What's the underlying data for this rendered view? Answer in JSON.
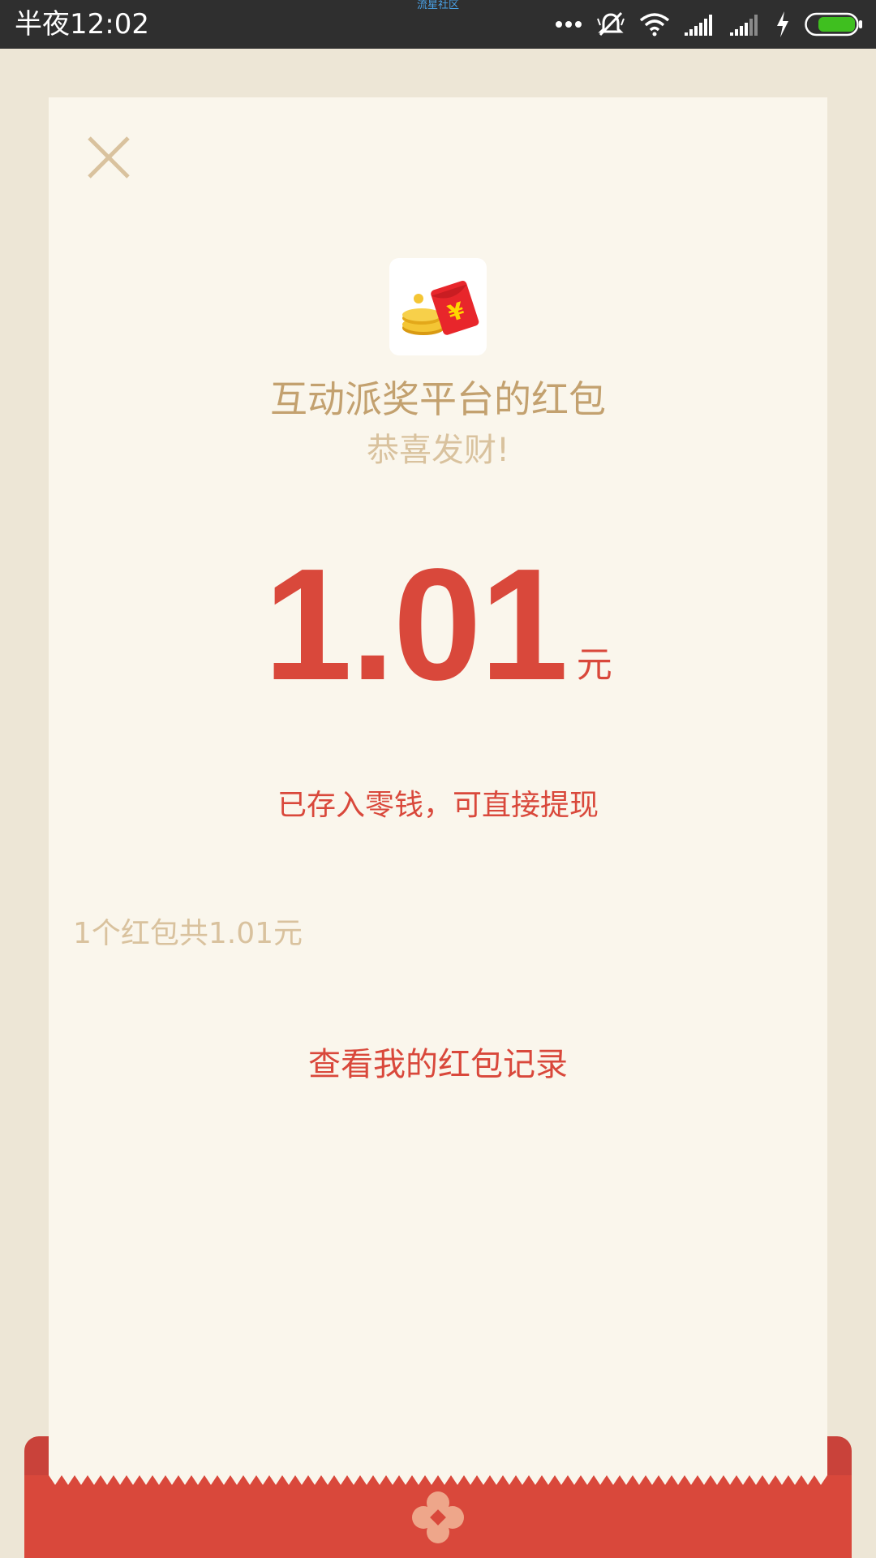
{
  "status_bar": {
    "time": "半夜12:02",
    "center_text": "流星社区",
    "icons": [
      "more-dots-icon",
      "alarm-off-icon",
      "wifi-icon",
      "signal-1-icon",
      "signal-2-icon",
      "charging-icon",
      "battery-icon"
    ]
  },
  "red_packet": {
    "sender_name": "互动派奖平台的红包",
    "greeting": "恭喜发财!",
    "amount": "1.01",
    "unit": "元",
    "stored_note": "已存入零钱，可直接提现",
    "summary": "1个红包共1.01元",
    "records_link": "查看我的红包记录"
  },
  "colors": {
    "background": "#ede6d6",
    "card": "#faf6ec",
    "accent_red": "#d9483b",
    "gold_text": "#c3a16f",
    "light_gold_text": "#d9c29e"
  }
}
